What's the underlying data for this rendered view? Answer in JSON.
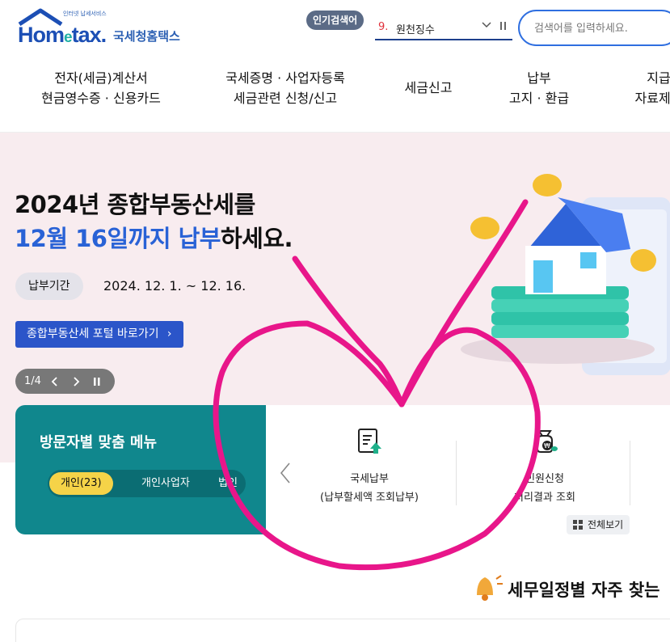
{
  "header": {
    "logo_small_text": "인터넷 납세서비스",
    "logo_word_left": "Hom",
    "logo_word_e": "e",
    "logo_word_right": "tax.",
    "logo_korean": "국세청홈택스",
    "popular_label": "인기검색어",
    "popular_rank": "9.",
    "popular_term": "원천징수",
    "search_placeholder": "검색어를 입력하세요."
  },
  "nav": {
    "items": [
      {
        "line1": "전자(세금)계산서",
        "line2": "현금영수증 · 신용카드"
      },
      {
        "line1": "국세증명 · 사업자등록",
        "line2": "세금관련 신청/신고"
      },
      {
        "line1": "세금신고",
        "line2": ""
      },
      {
        "line1": "납부",
        "line2": "고지 · 환급"
      },
      {
        "line1": "지급",
        "line2": "자료제출"
      }
    ]
  },
  "banner": {
    "headline_line1": "2024년 종합부동산세를",
    "headline_line2_blue": "12월 16일까지 납부",
    "headline_line2_rest": "하세요.",
    "period_label": "납부기간",
    "period_value": "2024. 12. 1. ~ 12. 16.",
    "portal_button": "종합부동산세 포털 바로가기",
    "slide_counter": "1/4"
  },
  "quick_menu": {
    "title": "방문자별 맞춤 메뉴",
    "tabs": [
      {
        "label": "개인(23)",
        "active": true
      },
      {
        "label": "개인사업자",
        "active": false
      },
      {
        "label": "법인",
        "active": false
      }
    ],
    "items": [
      {
        "label1": "국세납부",
        "label2": "(납부할세액 조회납부)",
        "icon": "tax-payment-doc-icon"
      },
      {
        "label1": "민원신청",
        "label2": "처리결과 조회",
        "icon": "money-bag-icon"
      }
    ],
    "view_all": "전체보기"
  },
  "bottom": {
    "title": "세무일정별 자주 찾는"
  },
  "colors": {
    "brand_blue": "#2962d6",
    "teal": "#10878d",
    "highlight_yellow": "#f5d348",
    "banner_bg": "#f8ecef",
    "annotation_magenta": "#e8168a"
  }
}
